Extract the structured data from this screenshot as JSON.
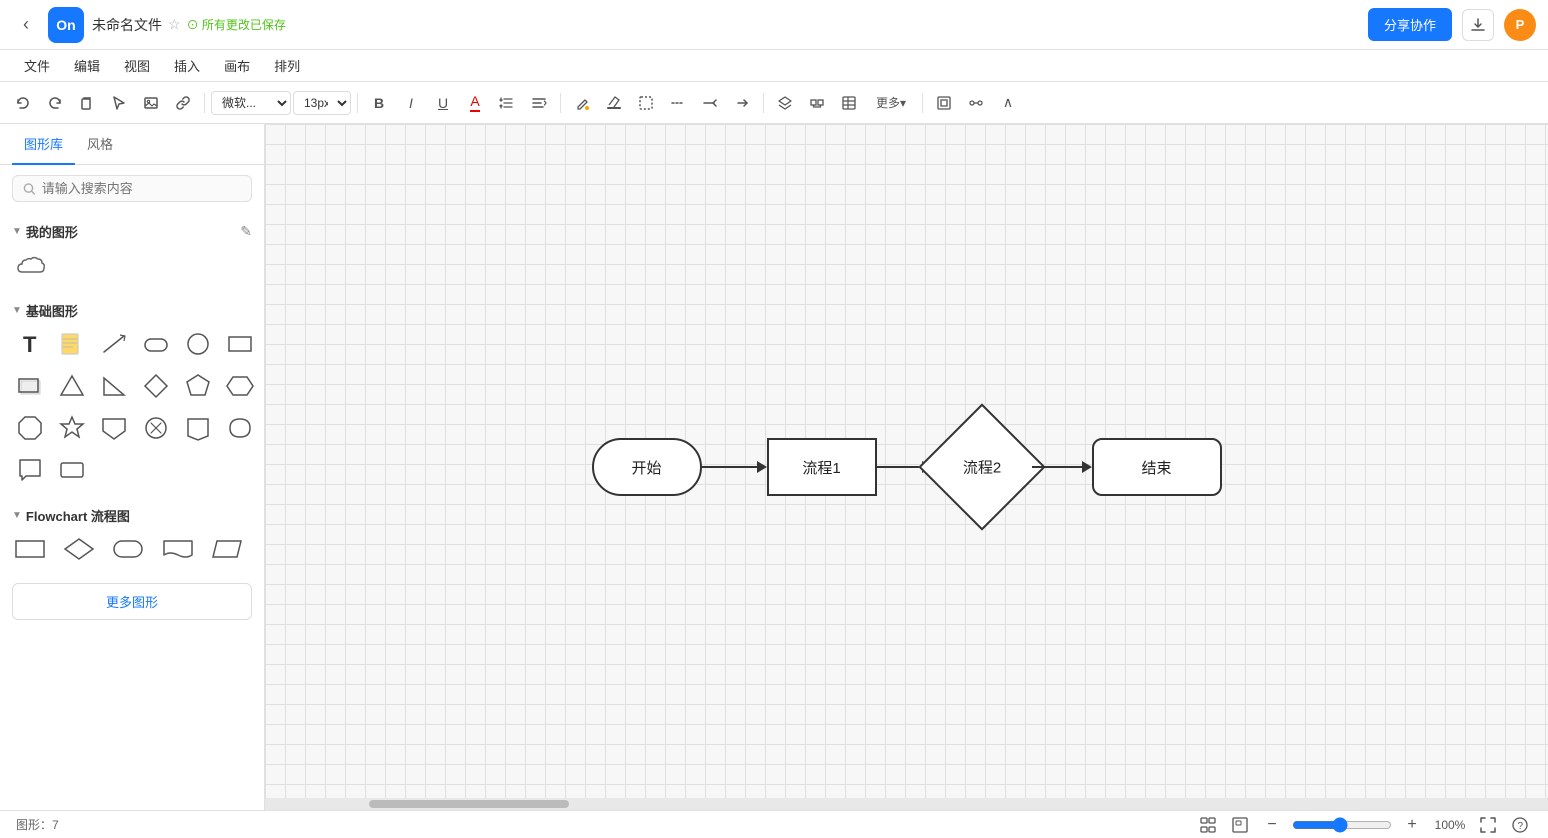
{
  "app": {
    "logo_text": "On",
    "back_button_label": "‹",
    "file_title": "未命名文件",
    "save_status": "⊙ 所有更改已保存",
    "share_button": "分享协作",
    "download_icon": "↓",
    "user_initial": "P"
  },
  "menubar": {
    "items": [
      "文件",
      "编辑",
      "视图",
      "插入",
      "画布",
      "排列"
    ]
  },
  "toolbar": {
    "undo_label": "←",
    "redo_label": "→",
    "font_name": "微软...",
    "font_size": "13px",
    "bold_label": "B",
    "italic_label": "I",
    "underline_label": "U",
    "font_color_label": "A",
    "line_height_label": "≡",
    "align_label": "≡",
    "fill_label": "▣",
    "stroke_label": "—",
    "border_label": "□",
    "more_label": "更多▾",
    "zoom_fit_label": "⊡",
    "connection_label": "⇌",
    "collapse_label": "∧"
  },
  "left_panel": {
    "tabs": [
      "图形库",
      "风格"
    ],
    "active_tab": "图形库",
    "search_placeholder": "请输入搜索内容",
    "sections": [
      {
        "id": "my-shapes",
        "title": "我的图形",
        "shapes": [
          {
            "name": "cloud",
            "type": "cloud"
          }
        ]
      },
      {
        "id": "basic-shapes",
        "title": "基础图形",
        "shapes": [
          {
            "name": "text",
            "type": "text"
          },
          {
            "name": "note",
            "type": "note"
          },
          {
            "name": "line",
            "type": "line"
          },
          {
            "name": "rounded-rect-small",
            "type": "rounded-rect-small"
          },
          {
            "name": "circle",
            "type": "circle"
          },
          {
            "name": "rect",
            "type": "rect"
          },
          {
            "name": "rect-shadow",
            "type": "rect-shadow"
          },
          {
            "name": "triangle",
            "type": "triangle"
          },
          {
            "name": "right-triangle",
            "type": "right-triangle"
          },
          {
            "name": "diamond",
            "type": "diamond"
          },
          {
            "name": "pentagon",
            "type": "pentagon"
          },
          {
            "name": "hexagon",
            "type": "hexagon"
          },
          {
            "name": "octagon",
            "type": "octagon"
          },
          {
            "name": "star",
            "type": "star"
          },
          {
            "name": "shield",
            "type": "shield"
          },
          {
            "name": "cross-circle",
            "type": "cross-circle"
          },
          {
            "name": "pentagon-irregular",
            "type": "pentagon-irregular"
          },
          {
            "name": "rounded-frame",
            "type": "rounded-frame"
          },
          {
            "name": "speech-bubble",
            "type": "speech-bubble"
          },
          {
            "name": "frame-rect",
            "type": "frame-rect"
          }
        ]
      },
      {
        "id": "flowchart",
        "title": "Flowchart 流程图",
        "shapes": [
          {
            "name": "fc-rect",
            "type": "fc-rect"
          },
          {
            "name": "fc-diamond",
            "type": "fc-diamond"
          },
          {
            "name": "fc-rounded",
            "type": "fc-rounded"
          },
          {
            "name": "fc-doc",
            "type": "fc-doc"
          },
          {
            "name": "fc-parallelogram",
            "type": "fc-parallelogram"
          }
        ]
      }
    ],
    "more_shapes_button": "更多图形"
  },
  "canvas": {
    "flowchart_nodes": [
      {
        "id": "start",
        "label": "开始",
        "type": "rounded-rect"
      },
      {
        "id": "process1",
        "label": "流程1",
        "type": "rect"
      },
      {
        "id": "process2",
        "label": "流程2",
        "type": "diamond"
      },
      {
        "id": "end",
        "label": "结束",
        "type": "rounded-rect2"
      }
    ]
  },
  "status_bar": {
    "shapes_count_label": "图形：",
    "shapes_count": "7",
    "zoom_level": "100%"
  }
}
